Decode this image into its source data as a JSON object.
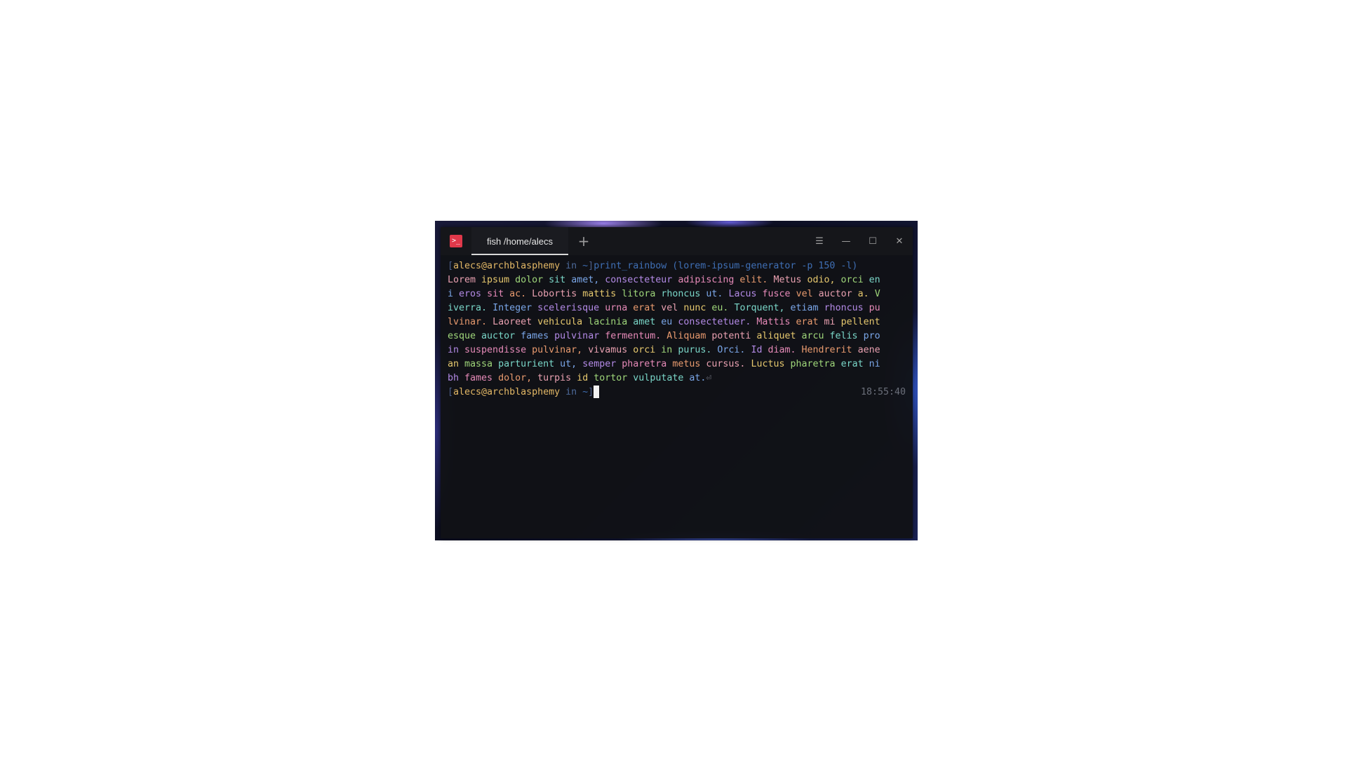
{
  "window": {
    "tab_title": "fish /home/alecs",
    "new_tab_label": "+",
    "menu_label": "☰",
    "minimize_label": "—",
    "maximize_label": "☐",
    "close_label": "✕",
    "app_icon_label": ">_"
  },
  "prompt1": {
    "open": "[",
    "user": "alecs@archblasphemy",
    "in": " in ",
    "dir": "~",
    "close": "]",
    "command": "print_rainbow (lorem-ipsum-generator -p 150 -l)"
  },
  "output": {
    "lines": [
      "Lorem ipsum dolor sit amet, consecteteur adipiscing elit. Metus odio, orci en",
      "i eros sit ac. Lobortis mattis litora rhoncus ut. Lacus fusce vel auctor a. V",
      "iverra. Integer scelerisque urna erat vel nunc eu. Torquent, etiam rhoncus pu",
      "lvinar. Laoreet vehicula lacinia amet eu consectetuer. Mattis erat mi pellent",
      "esque auctor fames pulvinar fermentum. Aliquam potenti aliquet arcu felis pro",
      "in suspendisse pulvinar, vivamus orci in purus. Orci. Id diam. Hendrerit aene",
      "an massa parturient ut, semper pharetra metus cursus. Luctus pharetra erat ni",
      "bh fames dolor, turpis id tortor vulputate at."
    ],
    "return_symbol": "⏎",
    "rainbow": [
      "#e8a0b0",
      "#e6c86e",
      "#9fd67a",
      "#7ad6c8",
      "#7aa6e8",
      "#b38ae6",
      "#e68ab8",
      "#e89a6e"
    ]
  },
  "prompt2": {
    "open": "[",
    "user": "alecs@archblasphemy",
    "in": " in ",
    "dir": "~",
    "close": "]",
    "time": "18:55:40"
  }
}
